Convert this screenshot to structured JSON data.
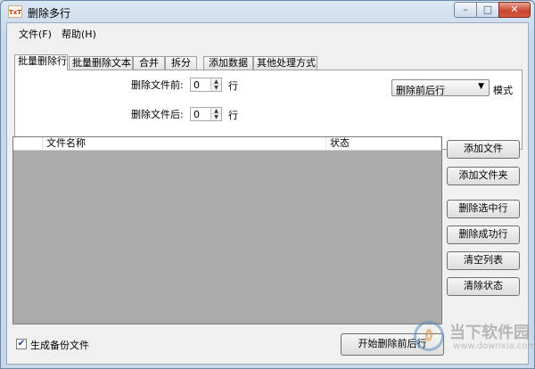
{
  "window": {
    "title": "删除多行",
    "app_icon_text": "TxT",
    "controls": {
      "minimize": "–",
      "maximize": "□",
      "close": "✕"
    }
  },
  "menu": [
    {
      "label": "文件(F)"
    },
    {
      "label": "帮助(H)"
    }
  ],
  "tabs": [
    {
      "label": "批量删除行",
      "active": true
    },
    {
      "label": "批量删除文本",
      "active": false
    },
    {
      "label": "合并",
      "active": false
    },
    {
      "label": "拆分",
      "active": false
    },
    {
      "label": "添加数据",
      "active": false
    },
    {
      "label": "其他处理方式",
      "active": false
    }
  ],
  "panel": {
    "before_label": "删除文件前:",
    "before_value": "0",
    "after_label": "删除文件后:",
    "after_value": "0",
    "unit": "行",
    "mode_selected": "删除前后行",
    "mode_label": "模式"
  },
  "list": {
    "columns": [
      "文件名称",
      "状态"
    ],
    "rows": []
  },
  "buttons": {
    "add_file": "添加文件",
    "add_folder": "添加文件夹",
    "delete_selected": "删除选中行",
    "delete_success": "删除成功行",
    "clear_list": "清空列表",
    "clear_status": "清除状态",
    "start": "开始删除前后行"
  },
  "backup": {
    "label": "生成备份文件",
    "checked": true,
    "check_glyph": "✔"
  },
  "watermark": {
    "line1": "当下软件园",
    "line2": "www.downxia.com"
  },
  "icons": {
    "spin_up": "▲",
    "spin_down": "▼",
    "combo_arrow": "▼"
  }
}
